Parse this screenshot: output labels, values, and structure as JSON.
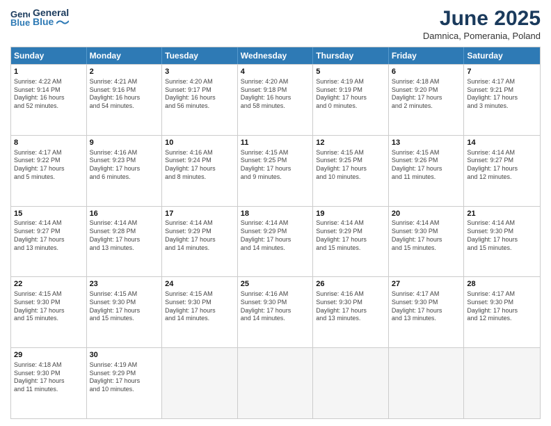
{
  "header": {
    "logo_line1": "General",
    "logo_line2": "Blue",
    "month": "June 2025",
    "location": "Damnica, Pomerania, Poland"
  },
  "days_of_week": [
    "Sunday",
    "Monday",
    "Tuesday",
    "Wednesday",
    "Thursday",
    "Friday",
    "Saturday"
  ],
  "weeks": [
    [
      {
        "day": "1",
        "lines": [
          "Sunrise: 4:22 AM",
          "Sunset: 9:14 PM",
          "Daylight: 16 hours",
          "and 52 minutes."
        ]
      },
      {
        "day": "2",
        "lines": [
          "Sunrise: 4:21 AM",
          "Sunset: 9:16 PM",
          "Daylight: 16 hours",
          "and 54 minutes."
        ]
      },
      {
        "day": "3",
        "lines": [
          "Sunrise: 4:20 AM",
          "Sunset: 9:17 PM",
          "Daylight: 16 hours",
          "and 56 minutes."
        ]
      },
      {
        "day": "4",
        "lines": [
          "Sunrise: 4:20 AM",
          "Sunset: 9:18 PM",
          "Daylight: 16 hours",
          "and 58 minutes."
        ]
      },
      {
        "day": "5",
        "lines": [
          "Sunrise: 4:19 AM",
          "Sunset: 9:19 PM",
          "Daylight: 17 hours",
          "and 0 minutes."
        ]
      },
      {
        "day": "6",
        "lines": [
          "Sunrise: 4:18 AM",
          "Sunset: 9:20 PM",
          "Daylight: 17 hours",
          "and 2 minutes."
        ]
      },
      {
        "day": "7",
        "lines": [
          "Sunrise: 4:17 AM",
          "Sunset: 9:21 PM",
          "Daylight: 17 hours",
          "and 3 minutes."
        ]
      }
    ],
    [
      {
        "day": "8",
        "lines": [
          "Sunrise: 4:17 AM",
          "Sunset: 9:22 PM",
          "Daylight: 17 hours",
          "and 5 minutes."
        ]
      },
      {
        "day": "9",
        "lines": [
          "Sunrise: 4:16 AM",
          "Sunset: 9:23 PM",
          "Daylight: 17 hours",
          "and 6 minutes."
        ]
      },
      {
        "day": "10",
        "lines": [
          "Sunrise: 4:16 AM",
          "Sunset: 9:24 PM",
          "Daylight: 17 hours",
          "and 8 minutes."
        ]
      },
      {
        "day": "11",
        "lines": [
          "Sunrise: 4:15 AM",
          "Sunset: 9:25 PM",
          "Daylight: 17 hours",
          "and 9 minutes."
        ]
      },
      {
        "day": "12",
        "lines": [
          "Sunrise: 4:15 AM",
          "Sunset: 9:25 PM",
          "Daylight: 17 hours",
          "and 10 minutes."
        ]
      },
      {
        "day": "13",
        "lines": [
          "Sunrise: 4:15 AM",
          "Sunset: 9:26 PM",
          "Daylight: 17 hours",
          "and 11 minutes."
        ]
      },
      {
        "day": "14",
        "lines": [
          "Sunrise: 4:14 AM",
          "Sunset: 9:27 PM",
          "Daylight: 17 hours",
          "and 12 minutes."
        ]
      }
    ],
    [
      {
        "day": "15",
        "lines": [
          "Sunrise: 4:14 AM",
          "Sunset: 9:27 PM",
          "Daylight: 17 hours",
          "and 13 minutes."
        ]
      },
      {
        "day": "16",
        "lines": [
          "Sunrise: 4:14 AM",
          "Sunset: 9:28 PM",
          "Daylight: 17 hours",
          "and 13 minutes."
        ]
      },
      {
        "day": "17",
        "lines": [
          "Sunrise: 4:14 AM",
          "Sunset: 9:29 PM",
          "Daylight: 17 hours",
          "and 14 minutes."
        ]
      },
      {
        "day": "18",
        "lines": [
          "Sunrise: 4:14 AM",
          "Sunset: 9:29 PM",
          "Daylight: 17 hours",
          "and 14 minutes."
        ]
      },
      {
        "day": "19",
        "lines": [
          "Sunrise: 4:14 AM",
          "Sunset: 9:29 PM",
          "Daylight: 17 hours",
          "and 15 minutes."
        ]
      },
      {
        "day": "20",
        "lines": [
          "Sunrise: 4:14 AM",
          "Sunset: 9:30 PM",
          "Daylight: 17 hours",
          "and 15 minutes."
        ]
      },
      {
        "day": "21",
        "lines": [
          "Sunrise: 4:14 AM",
          "Sunset: 9:30 PM",
          "Daylight: 17 hours",
          "and 15 minutes."
        ]
      }
    ],
    [
      {
        "day": "22",
        "lines": [
          "Sunrise: 4:15 AM",
          "Sunset: 9:30 PM",
          "Daylight: 17 hours",
          "and 15 minutes."
        ]
      },
      {
        "day": "23",
        "lines": [
          "Sunrise: 4:15 AM",
          "Sunset: 9:30 PM",
          "Daylight: 17 hours",
          "and 15 minutes."
        ]
      },
      {
        "day": "24",
        "lines": [
          "Sunrise: 4:15 AM",
          "Sunset: 9:30 PM",
          "Daylight: 17 hours",
          "and 14 minutes."
        ]
      },
      {
        "day": "25",
        "lines": [
          "Sunrise: 4:16 AM",
          "Sunset: 9:30 PM",
          "Daylight: 17 hours",
          "and 14 minutes."
        ]
      },
      {
        "day": "26",
        "lines": [
          "Sunrise: 4:16 AM",
          "Sunset: 9:30 PM",
          "Daylight: 17 hours",
          "and 13 minutes."
        ]
      },
      {
        "day": "27",
        "lines": [
          "Sunrise: 4:17 AM",
          "Sunset: 9:30 PM",
          "Daylight: 17 hours",
          "and 13 minutes."
        ]
      },
      {
        "day": "28",
        "lines": [
          "Sunrise: 4:17 AM",
          "Sunset: 9:30 PM",
          "Daylight: 17 hours",
          "and 12 minutes."
        ]
      }
    ],
    [
      {
        "day": "29",
        "lines": [
          "Sunrise: 4:18 AM",
          "Sunset: 9:30 PM",
          "Daylight: 17 hours",
          "and 11 minutes."
        ]
      },
      {
        "day": "30",
        "lines": [
          "Sunrise: 4:19 AM",
          "Sunset: 9:29 PM",
          "Daylight: 17 hours",
          "and 10 minutes."
        ]
      },
      {
        "day": "",
        "lines": []
      },
      {
        "day": "",
        "lines": []
      },
      {
        "day": "",
        "lines": []
      },
      {
        "day": "",
        "lines": []
      },
      {
        "day": "",
        "lines": []
      }
    ]
  ]
}
